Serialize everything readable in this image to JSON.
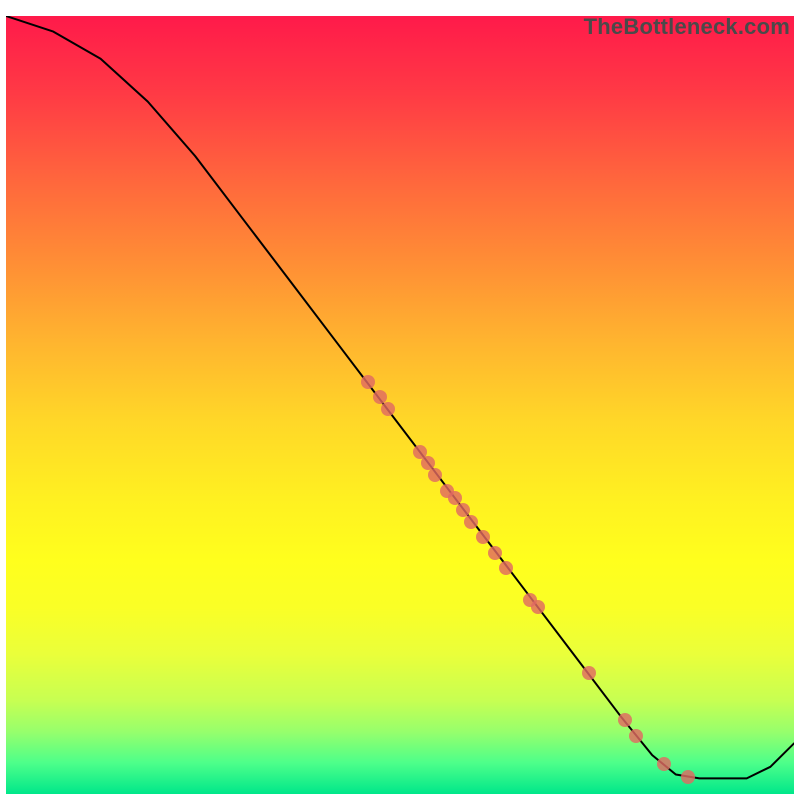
{
  "watermark": "TheBottleneck.com",
  "chart_data": {
    "type": "line",
    "title": "",
    "xlabel": "",
    "ylabel": "",
    "xlim": [
      0,
      100
    ],
    "ylim": [
      0,
      100
    ],
    "curve": [
      {
        "x": 0.0,
        "y": 100.0
      },
      {
        "x": 6.0,
        "y": 98.0
      },
      {
        "x": 12.0,
        "y": 94.5
      },
      {
        "x": 18.0,
        "y": 89.0
      },
      {
        "x": 24.0,
        "y": 82.0
      },
      {
        "x": 30.0,
        "y": 74.0
      },
      {
        "x": 36.0,
        "y": 66.0
      },
      {
        "x": 42.0,
        "y": 58.0
      },
      {
        "x": 48.0,
        "y": 50.0
      },
      {
        "x": 54.0,
        "y": 42.0
      },
      {
        "x": 60.0,
        "y": 34.0
      },
      {
        "x": 66.0,
        "y": 26.0
      },
      {
        "x": 72.0,
        "y": 18.0
      },
      {
        "x": 78.0,
        "y": 10.0
      },
      {
        "x": 82.0,
        "y": 5.0
      },
      {
        "x": 85.0,
        "y": 2.5
      },
      {
        "x": 88.0,
        "y": 2.0
      },
      {
        "x": 94.0,
        "y": 2.0
      },
      {
        "x": 97.0,
        "y": 3.5
      },
      {
        "x": 100.0,
        "y": 6.5
      }
    ],
    "points": [
      {
        "x": 46.0,
        "y": 53.0
      },
      {
        "x": 47.5,
        "y": 51.0
      },
      {
        "x": 48.5,
        "y": 49.5
      },
      {
        "x": 52.5,
        "y": 44.0
      },
      {
        "x": 53.5,
        "y": 42.5
      },
      {
        "x": 54.5,
        "y": 41.0
      },
      {
        "x": 56.0,
        "y": 39.0
      },
      {
        "x": 57.0,
        "y": 38.0
      },
      {
        "x": 58.0,
        "y": 36.5
      },
      {
        "x": 59.0,
        "y": 35.0
      },
      {
        "x": 60.5,
        "y": 33.0
      },
      {
        "x": 62.0,
        "y": 31.0
      },
      {
        "x": 63.5,
        "y": 29.0
      },
      {
        "x": 66.5,
        "y": 25.0
      },
      {
        "x": 67.5,
        "y": 24.0
      },
      {
        "x": 74.0,
        "y": 15.5
      },
      {
        "x": 78.5,
        "y": 9.5
      },
      {
        "x": 80.0,
        "y": 7.5
      },
      {
        "x": 83.5,
        "y": 3.8
      },
      {
        "x": 86.5,
        "y": 2.2
      }
    ]
  }
}
